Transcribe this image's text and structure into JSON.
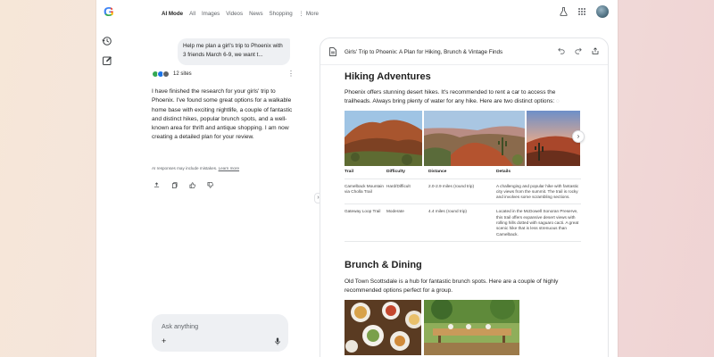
{
  "topbar": {
    "tabs": [
      "AI Mode",
      "All",
      "Images",
      "Videos",
      "News",
      "Shopping"
    ],
    "more_label": "More"
  },
  "chat": {
    "user_prompt": "Help me plan a girl's trip to Phoenix with 3 friends March 6-9, we want t...",
    "sites_label": "12 sites",
    "answer": "I have finished the research for your girls' trip to Phoenix. I've found some great options for a walkable home base with exciting nightlife, a couple of fantastic and distinct hikes, popular brunch spots, and a well-known area for thrift and antique shopping. I am now creating a detailed plan for your review.",
    "disclaimer": "AI responses may include mistakes.",
    "learn_more": "Learn more",
    "ask_placeholder": "Ask anything"
  },
  "canvas": {
    "title": "Girls' Trip to Phoenix: A Plan for Hiking, Brunch & Vintage Finds",
    "hiking": {
      "heading": "Hiking Adventures",
      "intro": "Phoenix offers stunning desert hikes. It's recommended to rent a car to access the trailheads. Always bring plenty of water for any hike. Here are two distinct options:"
    },
    "table": {
      "headers": [
        "Trail",
        "Difficulty",
        "Distance",
        "Details"
      ],
      "rows": [
        [
          "Camelback Mountain via Cholla Trail",
          "Hard/Difficult",
          "2.0-2.9 miles (round trip)",
          "A challenging and popular hike with fantastic city views from the summit. The trail is rocky and involves some scrambling sections."
        ],
        [
          "Gateway Loop Trail",
          "Moderate",
          "4.4 miles (round trip)",
          "Located in the McDowell Sonoran Preserve, this trail offers expansive desert views with rolling hills dotted with saguaro cacti. A great scenic hike that is less strenuous than Camelback."
        ]
      ]
    },
    "brunch": {
      "heading": "Brunch & Dining",
      "intro": "Old Town Scottsdale is a hub for fantastic brunch spots. Here are a couple of highly recommended options perfect for a group."
    }
  },
  "colors": {
    "accent": "#1a73e8",
    "surface": "#eef0f3",
    "text": "#1f1f1f",
    "muted": "#5f6368"
  },
  "icons": [
    "google-logo",
    "labs-flask-icon",
    "apps-grid-icon",
    "history-icon",
    "new-chat-icon",
    "share-icon",
    "copy-icon",
    "thumbs-up-icon",
    "thumbs-down-icon",
    "plus-icon",
    "mic-icon",
    "document-icon",
    "undo-icon",
    "redo-icon",
    "chevron-right-icon"
  ]
}
